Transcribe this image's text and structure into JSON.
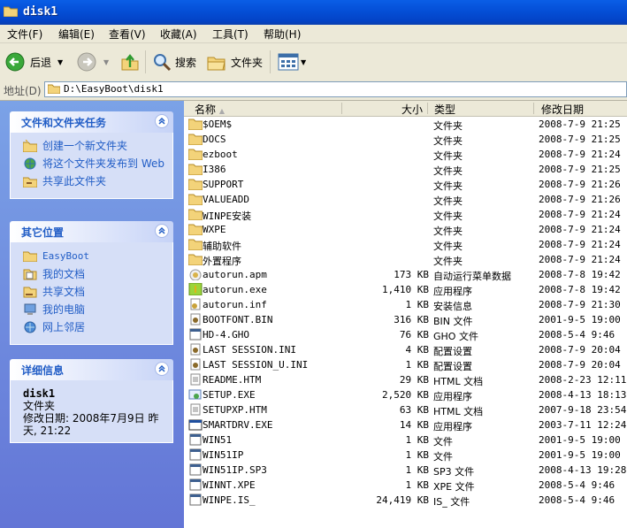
{
  "window": {
    "title": "disk1"
  },
  "menu": [
    "文件(F)",
    "编辑(E)",
    "查看(V)",
    "收藏(A)",
    "工具(T)",
    "帮助(H)"
  ],
  "toolbar": {
    "back": "后退",
    "search": "搜索",
    "folders": "文件夹"
  },
  "address": {
    "label": "地址(D)",
    "path": "D:\\EasyBoot\\disk1"
  },
  "tasks": {
    "title": "文件和文件夹任务",
    "items": [
      "创建一个新文件夹",
      "将这个文件夹发布到 Web",
      "共享此文件夹"
    ]
  },
  "places": {
    "title": "其它位置",
    "items": [
      "EasyBoot",
      "我的文档",
      "共享文档",
      "我的电脑",
      "网上邻居"
    ]
  },
  "details": {
    "title": "详细信息",
    "name": "disk1",
    "type": "文件夹",
    "modified": "修改日期: 2008年7月9日 昨天, 21:22"
  },
  "columns": {
    "name": "名称",
    "size": "大小",
    "type": "类型",
    "date": "修改日期"
  },
  "files": [
    {
      "name": "$OEM$",
      "size": "",
      "type": "文件夹",
      "date": "2008-7-9 21:25",
      "icon": "folder-icon"
    },
    {
      "name": "DOCS",
      "size": "",
      "type": "文件夹",
      "date": "2008-7-9 21:25",
      "icon": "folder-icon"
    },
    {
      "name": "ezboot",
      "size": "",
      "type": "文件夹",
      "date": "2008-7-9 21:24",
      "icon": "folder-icon"
    },
    {
      "name": "I386",
      "size": "",
      "type": "文件夹",
      "date": "2008-7-9 21:25",
      "icon": "folder-icon"
    },
    {
      "name": "SUPPORT",
      "size": "",
      "type": "文件夹",
      "date": "2008-7-9 21:26",
      "icon": "folder-icon"
    },
    {
      "name": "VALUEADD",
      "size": "",
      "type": "文件夹",
      "date": "2008-7-9 21:26",
      "icon": "folder-icon"
    },
    {
      "name": "WINPE安装",
      "size": "",
      "type": "文件夹",
      "date": "2008-7-9 21:24",
      "icon": "folder-icon"
    },
    {
      "name": "WXPE",
      "size": "",
      "type": "文件夹",
      "date": "2008-7-9 21:24",
      "icon": "folder-icon"
    },
    {
      "name": "辅助软件",
      "size": "",
      "type": "文件夹",
      "date": "2008-7-9 21:24",
      "icon": "folder-icon"
    },
    {
      "name": "外置程序",
      "size": "",
      "type": "文件夹",
      "date": "2008-7-9 21:24",
      "icon": "folder-icon"
    },
    {
      "name": "autorun.apm",
      "size": "173 KB",
      "type": "自动运行菜单数据",
      "date": "2008-7-8 19:42",
      "icon": "apm-file-icon"
    },
    {
      "name": "autorun.exe",
      "size": "1,410 KB",
      "type": "应用程序",
      "date": "2008-7-8 19:42",
      "icon": "autorun-exe-icon"
    },
    {
      "name": "autorun.inf",
      "size": "1 KB",
      "type": "安装信息",
      "date": "2008-7-9 21:30",
      "icon": "inf-file-icon"
    },
    {
      "name": "BOOTFONT.BIN",
      "size": "316 KB",
      "type": "BIN 文件",
      "date": "2001-9-5 19:00",
      "icon": "config-file-icon"
    },
    {
      "name": "HD-4.GHO",
      "size": "76 KB",
      "type": "GHO 文件",
      "date": "2008-5-4 9:46",
      "icon": "generic-file-icon"
    },
    {
      "name": "LAST SESSION.INI",
      "size": "4 KB",
      "type": "配置设置",
      "date": "2008-7-9 20:04",
      "icon": "config-file-icon"
    },
    {
      "name": "LAST SESSION_U.INI",
      "size": "1 KB",
      "type": "配置设置",
      "date": "2008-7-9 20:04",
      "icon": "config-file-icon"
    },
    {
      "name": "README.HTM",
      "size": "29 KB",
      "type": "HTML 文档",
      "date": "2008-2-23 12:11",
      "icon": "document-icon"
    },
    {
      "name": "SETUP.EXE",
      "size": "2,520 KB",
      "type": "应用程序",
      "date": "2008-4-13 18:13",
      "icon": "setup-exe-icon"
    },
    {
      "name": "SETUPXP.HTM",
      "size": "63 KB",
      "type": "HTML 文档",
      "date": "2007-9-18 23:54",
      "icon": "document-icon"
    },
    {
      "name": "SMARTDRV.EXE",
      "size": "14 KB",
      "type": "应用程序",
      "date": "2003-7-11 12:24",
      "icon": "exe-icon"
    },
    {
      "name": "WIN51",
      "size": "1 KB",
      "type": "文件",
      "date": "2001-9-5 19:00",
      "icon": "generic-file-icon"
    },
    {
      "name": "WIN51IP",
      "size": "1 KB",
      "type": "文件",
      "date": "2001-9-5 19:00",
      "icon": "generic-file-icon"
    },
    {
      "name": "WIN51IP.SP3",
      "size": "1 KB",
      "type": "SP3 文件",
      "date": "2008-4-13 19:28",
      "icon": "generic-file-icon"
    },
    {
      "name": "WINNT.XPE",
      "size": "1 KB",
      "type": "XPE 文件",
      "date": "2008-5-4 9:46",
      "icon": "generic-file-icon"
    },
    {
      "name": "WINPE.IS_",
      "size": "24,419 KB",
      "type": "IS_ 文件",
      "date": "2008-5-4 9:46",
      "icon": "generic-file-icon"
    }
  ]
}
